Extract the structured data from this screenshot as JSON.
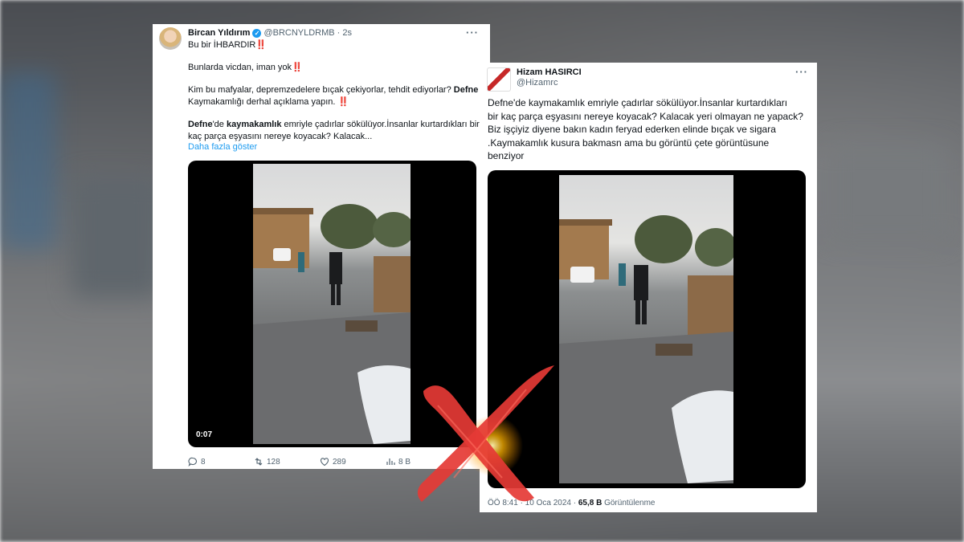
{
  "tweet1": {
    "name": "Bircan Yıldırım",
    "handle": "@BRCNYLDRMB",
    "time": "· 2s",
    "more": "···",
    "line1": "Bu bir İHBARDIR",
    "line2": "Bunlarda vicdan, iman yok",
    "line3a": "Kim bu mafyalar, depremzedelere bıçak çekiyorlar, tehdit ediyorlar?",
    "line3b": "Defne",
    "line3c": "Kaymakamlığı derhal açıklama yapın.",
    "line4a": "Defne",
    "line4b": "'de",
    "line4c": "kaymakamlık",
    "line4d": "emriyle çadırlar sökülüyor.İnsanlar kurtardıkları bir",
    "line4e": "kaç parça eşyasını nereye koyacak? Kalacak...",
    "show_more": "Daha fazla göster",
    "video_time": "0:07",
    "replies": "8",
    "retweets": "128",
    "likes": "289",
    "views": "8 B",
    "double_excl": "‼️"
  },
  "tweet2": {
    "name": "Hizam HASIRCI",
    "handle": "@Hizamrc",
    "more": "···",
    "text_l1": "Defne'de kaymakamlık emriyle çadırlar sökülüyor.İnsanlar kurtardıkları",
    "text_l2": "bir kaç parça eşyasını nereye koyacak? Kalacak yeri olmayan ne yapack?",
    "text_l3": "Biz işçiyiz diyene bakın  kadın feryad ederken elinde bıçak ve sigara",
    "text_l4": ".Kaymakamlık kusura bakmasn ama bu görüntü çete görüntüsune",
    "text_l5": "benziyor",
    "meta_time": "ÖÖ 8:41 · 10 Oca 2024 ·",
    "meta_views": "65,8 B",
    "meta_views_label": "Görüntülenme"
  },
  "colors": {
    "accent": "#1d9bf0",
    "cross": "#e53935",
    "glow": "#ffb300"
  }
}
